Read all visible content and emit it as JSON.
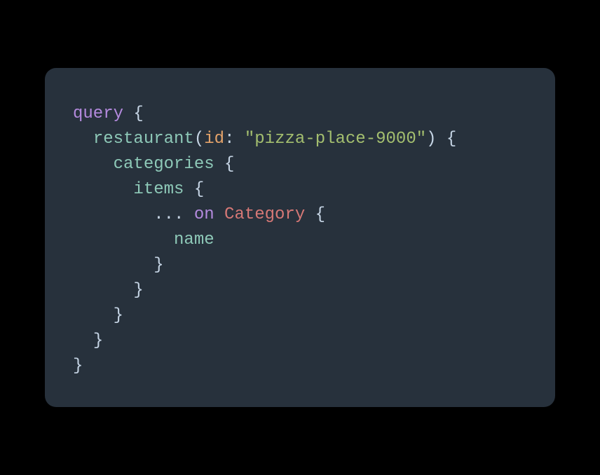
{
  "code": {
    "tokens": {
      "query": "query",
      "brace_open": " {",
      "restaurant": "restaurant",
      "paren_open": "(",
      "id_arg": "id",
      "colon": ": ",
      "id_value": "\"pizza-place-9000\"",
      "paren_close": ")",
      "brace_open2": " {",
      "categories": "categories",
      "brace_open3": " {",
      "items": "items",
      "brace_open4": " {",
      "spread": "...",
      "on": " on ",
      "category_type": "Category",
      "brace_open5": " {",
      "name": "name",
      "brace_close": "}",
      "indent1": "  ",
      "indent2": "    ",
      "indent3": "      ",
      "indent4": "        ",
      "indent5": "          "
    }
  }
}
